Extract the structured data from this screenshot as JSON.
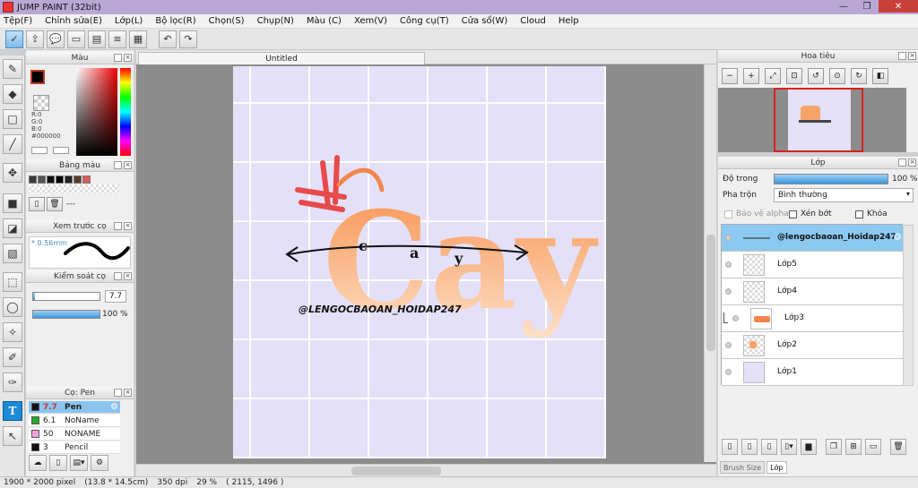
{
  "app": {
    "title": "JUMP PAINT (32bit)"
  },
  "window_controls": {
    "minimize": "—",
    "maximize": "❐",
    "close": "✕"
  },
  "menu": [
    "Tệp(F)",
    "Chỉnh sửa(E)",
    "Lớp(L)",
    "Bộ lọc(R)",
    "Chọn(S)",
    "Chụp(N)",
    "Màu (C)",
    "Xem(V)",
    "Công cụ(T)",
    "Cửa sổ(W)",
    "Cloud",
    "Help"
  ],
  "color_panel": {
    "title": "Màu",
    "r": "R:0",
    "g": "G:0",
    "b": "B:0",
    "hex": "#000000",
    "fg": "#000000",
    "bg": "#ffffff"
  },
  "swatch_panel": {
    "title": "Bảng màu",
    "colors": [
      "#3b3b3b",
      "#555555",
      "#111111",
      "#000000",
      "#222222",
      "#5a3e2b",
      "#e05a5a"
    ],
    "dash": "---"
  },
  "brush_preview_panel": {
    "title": "Xem trước cọ",
    "size": "0.56mm"
  },
  "brush_control_panel": {
    "title": "Kiểm soát cọ",
    "size_value": "7.7",
    "opacity_value": "100 %",
    "size_fill": 0.03,
    "opacity_fill": 1.0
  },
  "brush_list_panel": {
    "title": "Cọ: Pen",
    "items": [
      {
        "size": "7.7",
        "name": "Pen",
        "color": "#111111",
        "selected": true
      },
      {
        "size": "6.1",
        "name": "NoName",
        "color": "#22aa22",
        "selected": false
      },
      {
        "size": "50",
        "name": "NONAME",
        "color": "#f0a0e0",
        "selected": false
      },
      {
        "size": "3",
        "name": "Pencil",
        "color": "#111111",
        "selected": false
      }
    ]
  },
  "document": {
    "tab_title": "Untitled"
  },
  "artwork": {
    "title_word": "Cay",
    "small_letters": [
      "c",
      "a",
      "y"
    ],
    "watermark": "@LENGOCBAOAN_HOIDAP247"
  },
  "navigator_panel": {
    "title": "Hoa tiêu"
  },
  "layer_panel": {
    "title": "Lớp",
    "opacity_label": "Độ trong",
    "opacity_value": "100 %",
    "opacity_fill": 1.0,
    "blend_label": "Pha trộn",
    "blend_value": "Bình thường",
    "protect_alpha": "Bảo vệ alpha",
    "clip": "Xén bớt",
    "lock": "Khóa",
    "layers": [
      {
        "name": "@lengocbaoan_Hoidap247",
        "selected": true
      },
      {
        "name": "Lớp5",
        "selected": false
      },
      {
        "name": "Lớp4",
        "selected": false
      },
      {
        "name": "Lớp3",
        "selected": false
      },
      {
        "name": "Lớp2",
        "selected": false
      },
      {
        "name": "Lớp1",
        "selected": false
      }
    ]
  },
  "bottom_tabs": [
    "Brush Size",
    "Lớp"
  ],
  "status": {
    "pixels": "1900 * 2000 pixel",
    "cm": "(13.8 * 14.5cm)",
    "dpi": "350 dpi",
    "zoom": "29 %",
    "coords": "( 2115, 1496 )"
  },
  "colors": {
    "title_orange": "#f8a27a",
    "accent_red": "#e64a4a",
    "canvas_bg": "#e4e0f8",
    "selection_blue": "#8bc9f0"
  }
}
